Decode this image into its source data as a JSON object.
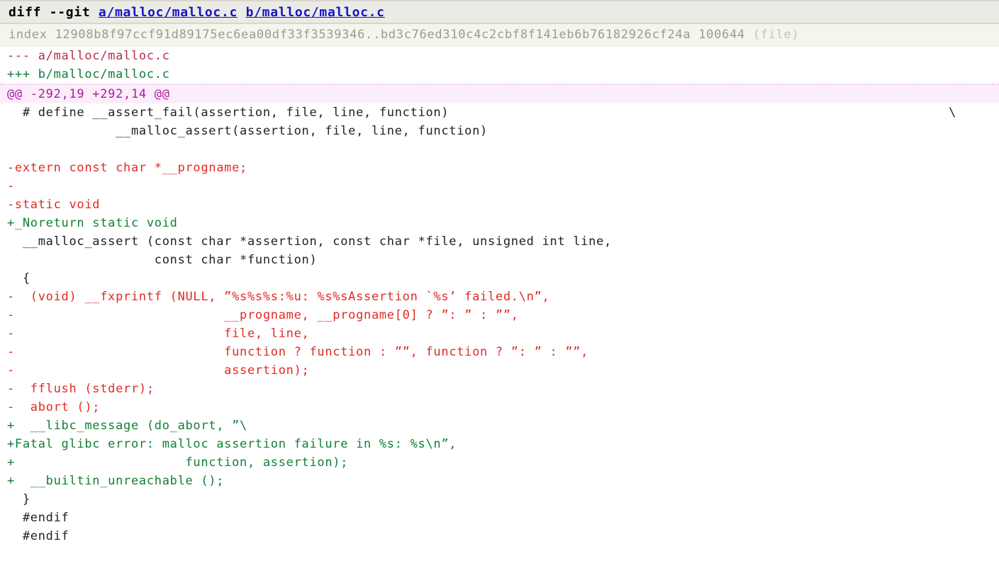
{
  "view": {
    "name": "git-diff-output",
    "background": "#ffffff",
    "colors": {
      "title_background": "#ebeae5",
      "title_text": "#000000",
      "link": "#1414c8",
      "index_background": "#f5f4ed",
      "index_text": "#9b9b93",
      "from_file": "#b4304a",
      "to_file": "#0f7b3a",
      "hunk_background": "#fbeefa",
      "hunk_text": "#b1179e",
      "removed": "#e02b24",
      "added": "#118033",
      "context": "#222222"
    }
  },
  "header": {
    "command": "diff --git ",
    "file_a": "a/malloc/malloc.c",
    "file_b": "b/malloc/malloc.c",
    "index_label": "index ",
    "index_hashes": "12908b8f97ccf91d89175ec6ea00df33f3539346..bd3c76ed310c4c2cbf8f141eb6b76182926cf24a",
    "index_mode": " 100644 ",
    "index_kind": "(file)",
    "from_file": "--- a/malloc/malloc.c",
    "to_file": "+++ b/malloc/malloc.c"
  },
  "hunk": {
    "header": "@@ -292,19 +292,14 @@",
    "old_start": 292,
    "old_count": 19,
    "new_start": 292,
    "new_count": 14
  },
  "lines": [
    {
      "kind": "context",
      "text": "  # define __assert_fail(assertion, file, line, function)"
    },
    {
      "kind": "context",
      "text": "              __malloc_assert(assertion, file, line, function)"
    },
    {
      "kind": "context",
      "text": ""
    },
    {
      "kind": "del",
      "text": "-extern const char *__progname;"
    },
    {
      "kind": "del",
      "text": "-"
    },
    {
      "kind": "del",
      "text": "-static void"
    },
    {
      "kind": "add",
      "text": "+_Noreturn static void"
    },
    {
      "kind": "context",
      "text": "  __malloc_assert (const char *assertion, const char *file, unsigned int line,"
    },
    {
      "kind": "context",
      "text": "                   const char *function)"
    },
    {
      "kind": "context",
      "text": "  {"
    },
    {
      "kind": "del",
      "text": "-  (void) __fxprintf (NULL, ”%s%s%s:%u: %s%sAssertion `%s’ failed.\\n”,"
    },
    {
      "kind": "del",
      "text": "-                           __progname, __progname[0] ? ”: ” : ””,"
    },
    {
      "kind": "del",
      "text": "-                           file, line,"
    },
    {
      "kind": "del",
      "text": "-                           function ? function : ””, function ? ”: ” : ””,"
    },
    {
      "kind": "del",
      "text": "-                           assertion);"
    },
    {
      "kind": "del",
      "text": "-  fflush (stderr);"
    },
    {
      "kind": "del",
      "text": "-  abort ();"
    },
    {
      "kind": "add",
      "text": "+  __libc_message (do_abort, ”\\"
    },
    {
      "kind": "add",
      "text": "+Fatal glibc error: malloc assertion failure in %s: %s\\n”,"
    },
    {
      "kind": "add",
      "text": "+                      function, assertion);"
    },
    {
      "kind": "add",
      "text": "+  __builtin_unreachable ();"
    },
    {
      "kind": "context",
      "text": "  }"
    },
    {
      "kind": "context",
      "text": "  #endif"
    },
    {
      "kind": "context",
      "text": "  #endif"
    }
  ],
  "annotations": {
    "line_continuation_backslash": "\\"
  }
}
